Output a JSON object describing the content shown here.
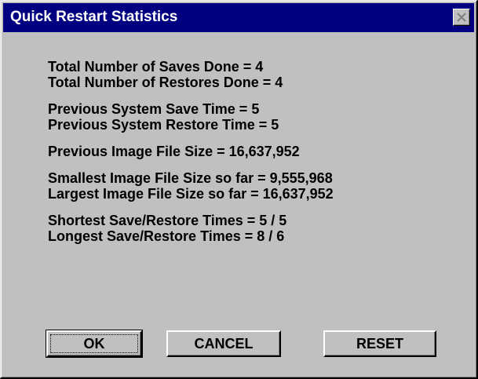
{
  "window": {
    "title": "Quick Restart Statistics",
    "close_icon": "close-icon"
  },
  "stats": {
    "saves_done": "Total Number of Saves Done = 4",
    "restores_done": "Total Number of Restores Done = 4",
    "prev_save_time": "Previous System Save Time = 5",
    "prev_restore_time": "Previous System Restore Time = 5",
    "prev_image_size": "Previous Image File Size = 16,637,952",
    "smallest_image_size": "Smallest Image File Size so far = 9,555,968",
    "largest_image_size": "Largest Image File Size so far = 16,637,952",
    "shortest_times": "Shortest Save/Restore Times = 5 / 5",
    "longest_times": "Longest Save/Restore Times = 8 / 6"
  },
  "buttons": {
    "ok": "OK",
    "cancel": "CANCEL",
    "reset": "RESET"
  },
  "colors": {
    "titlebar": "#000080",
    "face": "#c0c0c0",
    "title_text": "#ffffff"
  }
}
